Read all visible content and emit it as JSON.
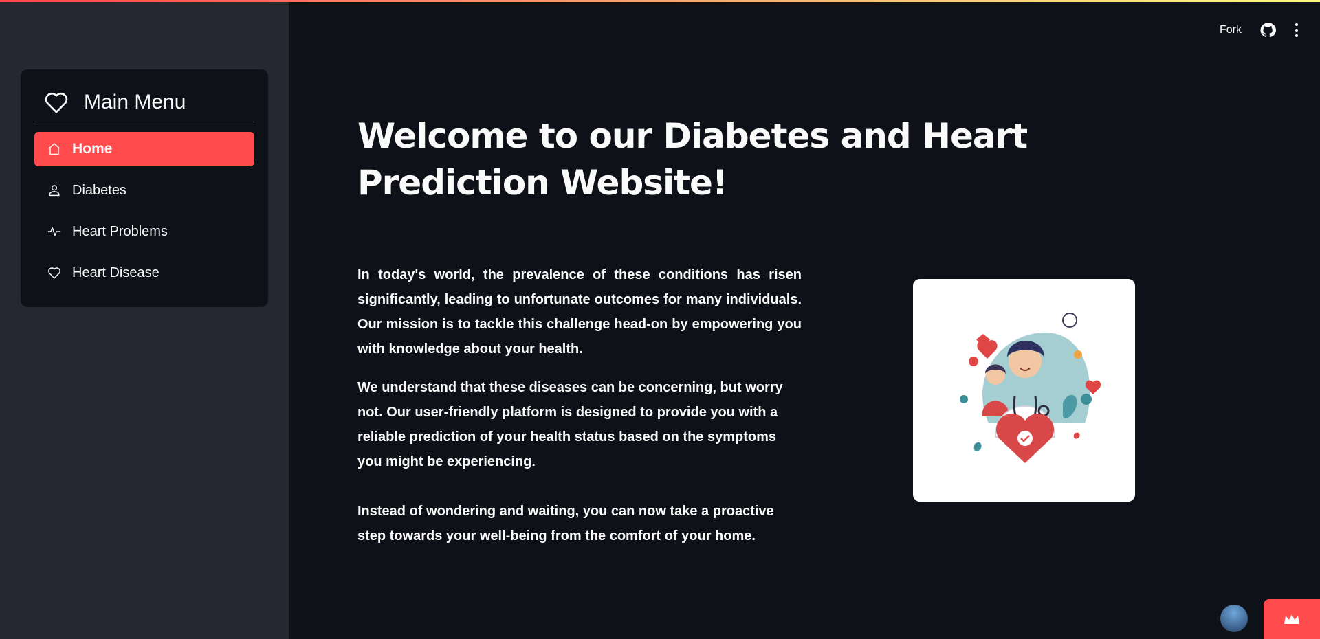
{
  "sidebar": {
    "menu_title": "Main Menu",
    "items": [
      {
        "label": "Home",
        "icon": "house-icon",
        "active": true
      },
      {
        "label": "Diabetes",
        "icon": "person-icon",
        "active": false
      },
      {
        "label": "Heart Problems",
        "icon": "activity-icon",
        "active": false
      },
      {
        "label": "Heart Disease",
        "icon": "heart-icon",
        "active": false
      }
    ]
  },
  "header": {
    "fork_label": "Fork",
    "icons": [
      "github-icon",
      "more-vertical-icon"
    ]
  },
  "main": {
    "title": "Welcome to our Diabetes and Heart Prediction Website!",
    "paragraphs": [
      "In today's world, the prevalence of these conditions has risen significantly, leading to unfortunate outcomes for many individuals. Our mission is to tackle this challenge head-on by empowering you with knowledge about your health.",
      "We understand that these diseases can be concerning, but worry not. Our user-friendly platform is designed to provide you with a reliable prediction of your health status based on the symptoms you might be experiencing.",
      "Instead of wondering and waiting, you can now take a proactive step towards your well-being from the comfort of your home."
    ]
  },
  "colors": {
    "accent": "#ff4b4b",
    "sidebar_bg": "#262730",
    "main_bg": "#0e1117",
    "text": "#fafafa"
  }
}
